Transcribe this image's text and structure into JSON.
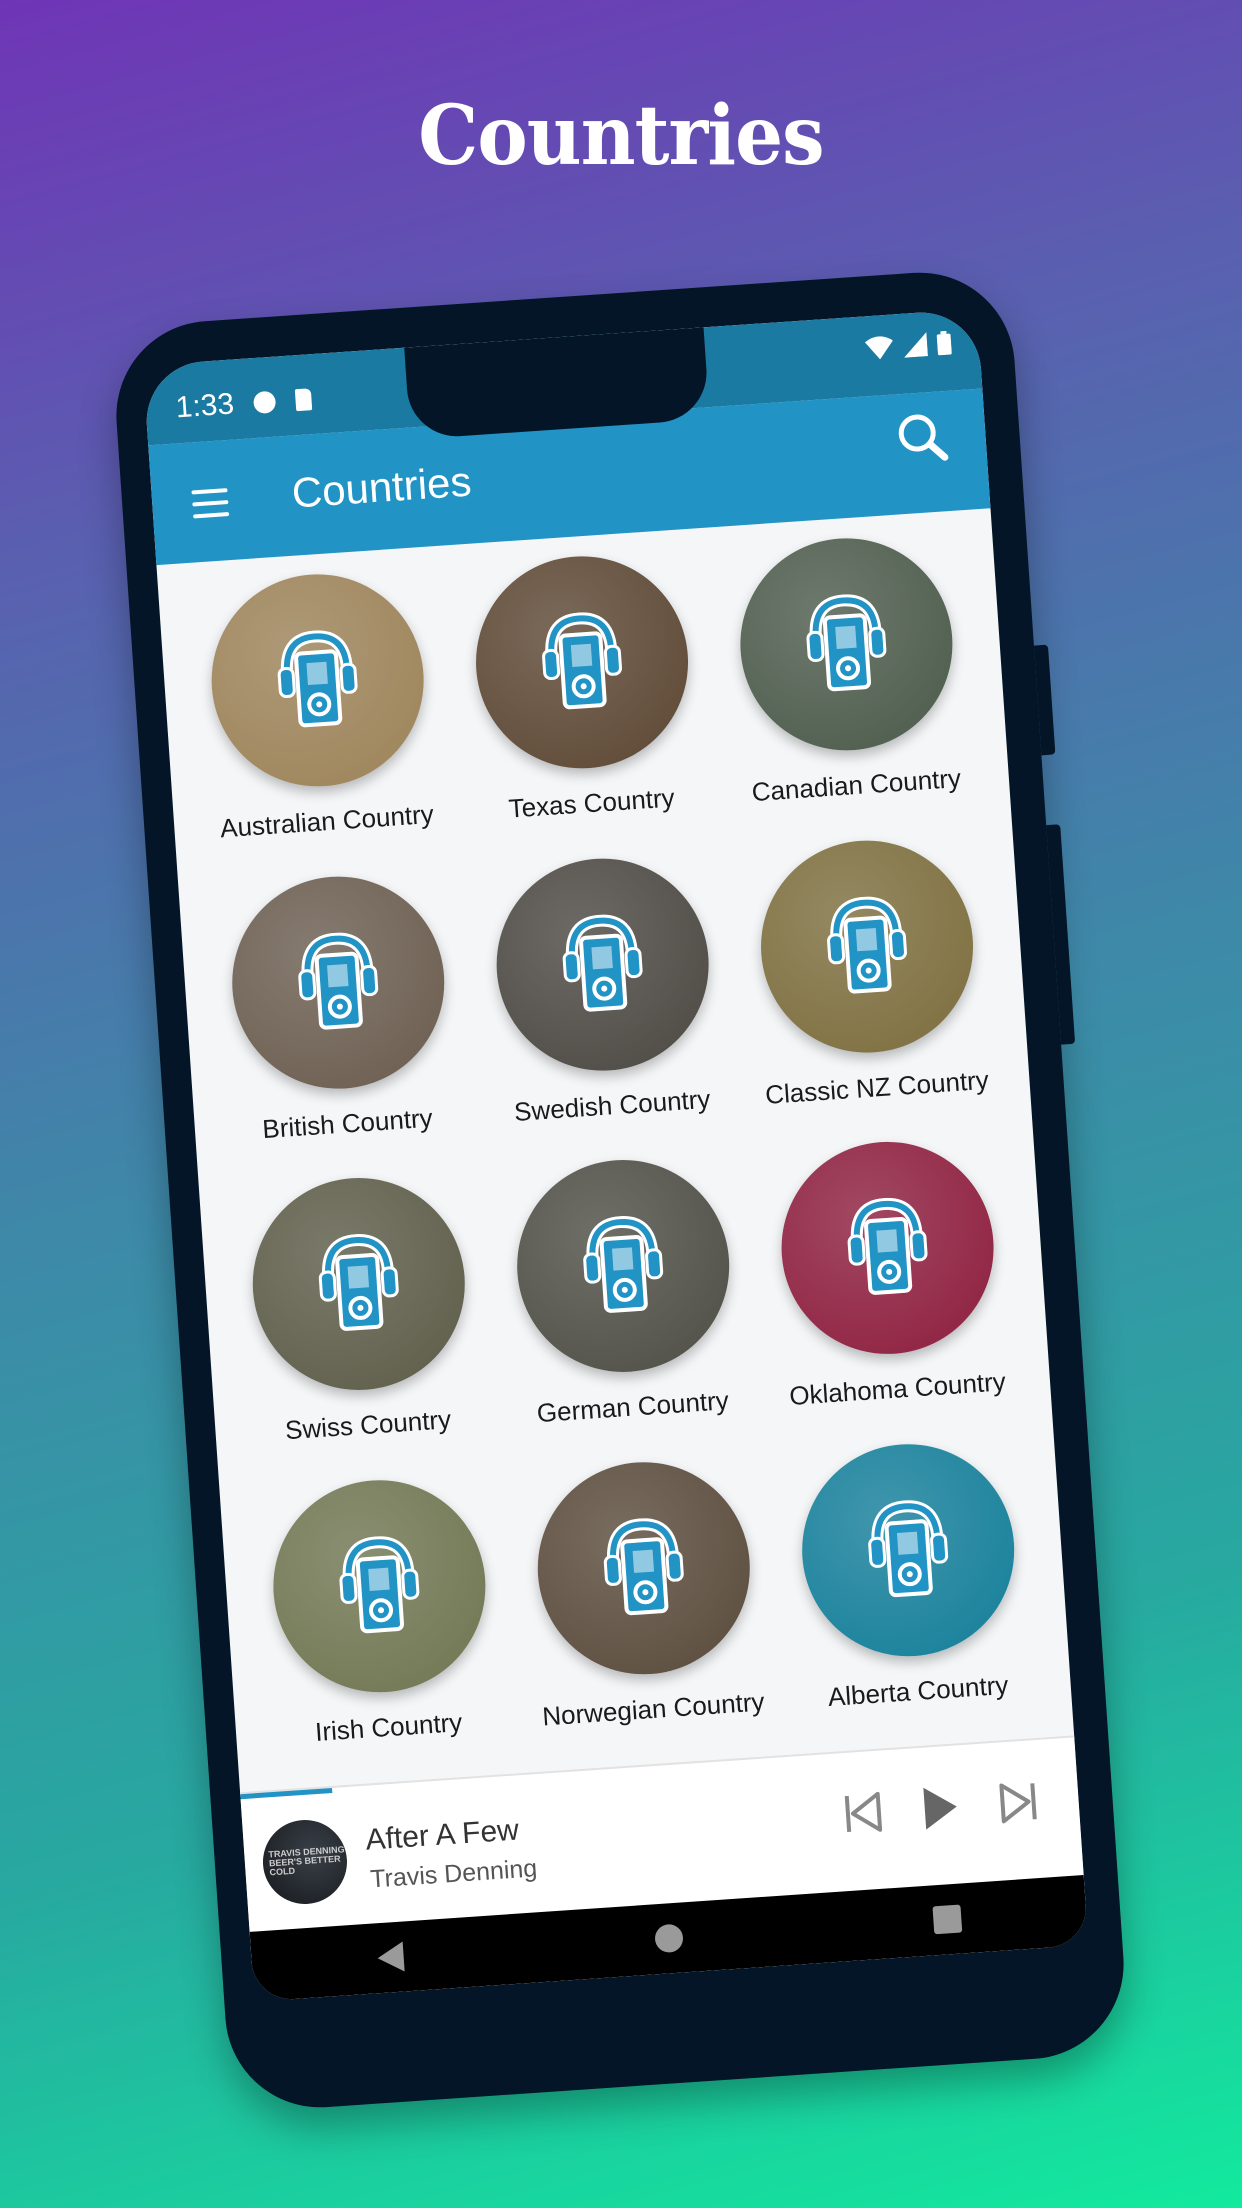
{
  "promo": {
    "title": "Countries"
  },
  "status_bar": {
    "time": "1:33",
    "left_icons": [
      "notification-icon",
      "sd-card-icon"
    ],
    "right_icons": [
      "wifi-icon",
      "signal-icon",
      "battery-icon"
    ]
  },
  "app_bar": {
    "title": "Countries",
    "menu_icon": "menu-icon",
    "search_icon": "search-icon"
  },
  "accent_color": "#2293c5",
  "stations": [
    {
      "label": "Australian Country",
      "color": "#9c8257"
    },
    {
      "label": "Texas Country",
      "color": "#5c4632"
    },
    {
      "label": "Canadian Country",
      "color": "#4b5a4a"
    },
    {
      "label": "British Country",
      "color": "#6a5c4e"
    },
    {
      "label": "Swedish Country",
      "color": "#4b4741"
    },
    {
      "label": "Classic NZ Country",
      "color": "#7c6d3c"
    },
    {
      "label": "Swiss Country",
      "color": "#5c5b47"
    },
    {
      "label": "German Country",
      "color": "#4d4d44"
    },
    {
      "label": "Oklahoma Country",
      "color": "#8d1d3d"
    },
    {
      "label": "Irish Country",
      "color": "#6f7550"
    },
    {
      "label": "Norwegian Country",
      "color": "#594a3a"
    },
    {
      "label": "Alberta Country",
      "color": "#137e99"
    }
  ],
  "player": {
    "track_title": "After A Few",
    "artist": "Travis Denning",
    "album_art_text": "TRAVIS DENNING BEER'S BETTER COLD",
    "progress_percent": 11
  },
  "nav": {
    "buttons": [
      "back",
      "home",
      "recents"
    ]
  }
}
